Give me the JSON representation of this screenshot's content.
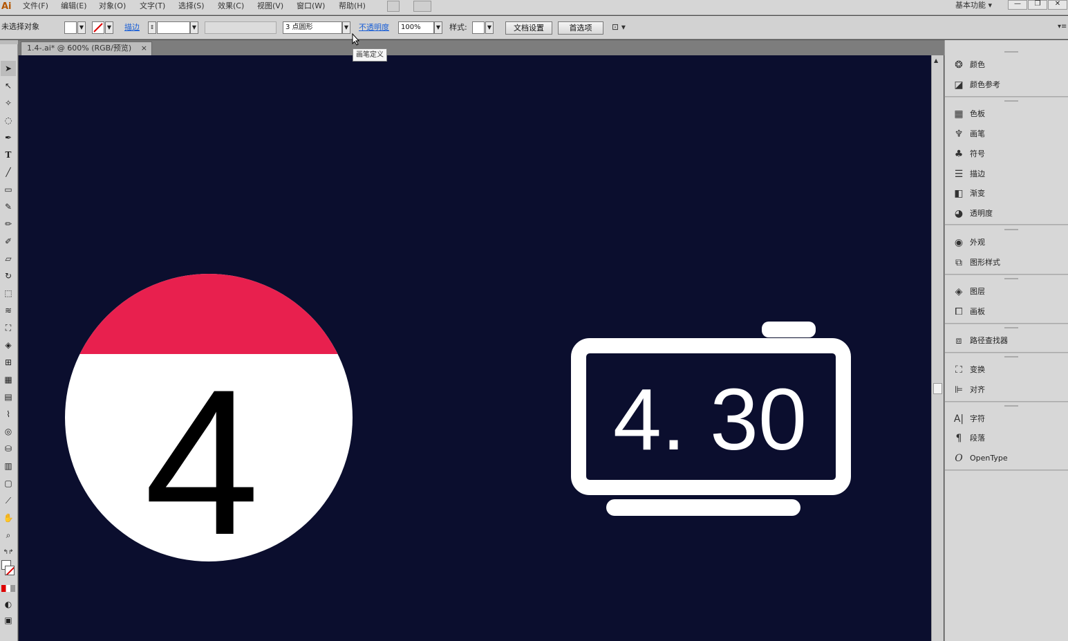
{
  "app": {
    "logo": "Ai"
  },
  "menu": [
    "文件(F)",
    "编辑(E)",
    "对象(O)",
    "文字(T)",
    "选择(S)",
    "效果(C)",
    "视图(V)",
    "窗口(W)",
    "帮助(H)"
  ],
  "workspace": {
    "label": "基本功能 ▾"
  },
  "window_buttons": {
    "minimize": "—",
    "restore": "❐",
    "close": "✕"
  },
  "control": {
    "selection_label": "未选择对象",
    "stroke_link": "描边",
    "brush_value": "3 点圆形",
    "opacity_link": "不透明度",
    "opacity_value": "100%",
    "style_label": "样式:",
    "doc_setup_button": "文档设置",
    "prefs_button": "首选项",
    "tooltip": "画笔定义"
  },
  "document": {
    "tab_title": "1.4-.ai* @ 600% (RGB/预览)",
    "tab_close": "×"
  },
  "artwork": {
    "calendar_number": "4",
    "clock_text": "4. 30",
    "colors": {
      "background": "#0b0e2e",
      "red": "#e8204e",
      "white": "#ffffff",
      "black": "#000000"
    }
  },
  "panels": {
    "groups": [
      [
        {
          "icon": "palette-icon",
          "label": "颜色"
        },
        {
          "icon": "color-guide-icon",
          "label": "颜色参考"
        }
      ],
      [
        {
          "icon": "swatches-icon",
          "label": "色板"
        },
        {
          "icon": "brush-icon",
          "label": "画笔"
        },
        {
          "icon": "symbol-icon",
          "label": "符号"
        },
        {
          "icon": "stroke-icon",
          "label": "描边"
        },
        {
          "icon": "gradient-icon",
          "label": "渐变"
        },
        {
          "icon": "transparency-icon",
          "label": "透明度"
        }
      ],
      [
        {
          "icon": "appearance-icon",
          "label": "外观"
        },
        {
          "icon": "graphic-styles-icon",
          "label": "图形样式"
        }
      ],
      [
        {
          "icon": "layers-icon",
          "label": "图层"
        },
        {
          "icon": "artboards-icon",
          "label": "画板"
        }
      ],
      [
        {
          "icon": "pathfinder-icon",
          "label": "路径查找器"
        }
      ],
      [
        {
          "icon": "transform-icon",
          "label": "变换"
        },
        {
          "icon": "align-icon",
          "label": "对齐"
        }
      ],
      [
        {
          "icon": "character-icon",
          "label": "字符"
        },
        {
          "icon": "paragraph-icon",
          "label": "段落"
        },
        {
          "icon": "opentype-icon",
          "label": "OpenType"
        }
      ]
    ]
  }
}
